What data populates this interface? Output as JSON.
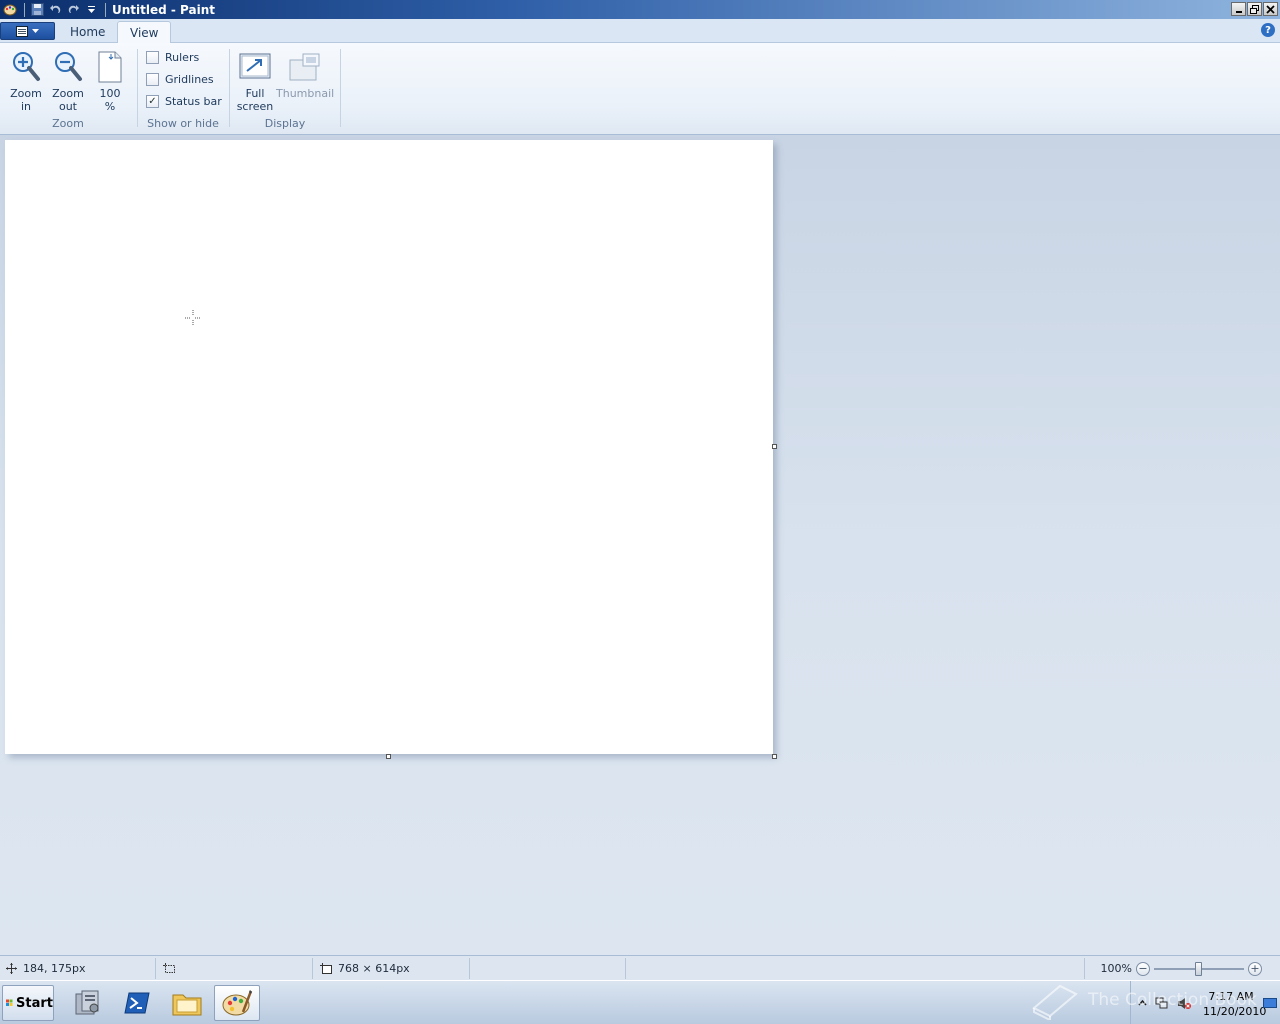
{
  "window": {
    "title": "Untitled - Paint"
  },
  "tabs": [
    {
      "label": "Home"
    },
    {
      "label": "View"
    }
  ],
  "ribbon": {
    "zoom_group": {
      "label": "Zoom",
      "zoom_in": {
        "line1": "Zoom",
        "line2": "in"
      },
      "zoom_out": {
        "line1": "Zoom",
        "line2": "out"
      },
      "hundred": {
        "line1": "100",
        "line2": "%"
      }
    },
    "show_hide_group": {
      "label": "Show or hide",
      "rulers": {
        "label": "Rulers",
        "checked": false
      },
      "gridlines": {
        "label": "Gridlines",
        "checked": false
      },
      "status_bar": {
        "label": "Status bar",
        "checked": true,
        "mark": "✓"
      }
    },
    "display_group": {
      "label": "Display",
      "full_screen": {
        "line1": "Full",
        "line2": "screen"
      },
      "thumbnail": {
        "label": "Thumbnail"
      }
    }
  },
  "statusbar": {
    "cursor_pos": "184, 175px",
    "selection_size": "",
    "image_size": "768 × 614px",
    "zoom": "100%"
  },
  "taskbar": {
    "start_label": "Start",
    "clock_time": "7:17 AM",
    "clock_date": "11/20/2010"
  },
  "watermark": "The Collection Book",
  "colors": {
    "titlebar": "#2f5fa8",
    "ribbon": "#eaf1f9",
    "workspace": "#d0dbe8",
    "canvas": "#ffffff"
  }
}
